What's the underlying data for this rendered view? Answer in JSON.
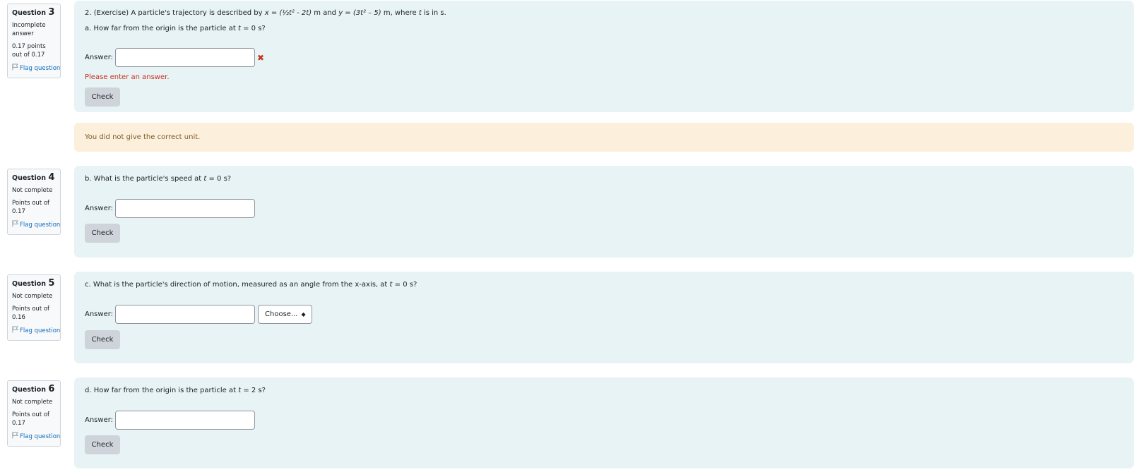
{
  "flag_label": "Flag question",
  "questions": [
    {
      "label": "Question",
      "number": "3",
      "state": "Incomplete answer",
      "grade": "0.17 points out of 0.17",
      "intro": {
        "prefix": "2. (Exercise) A particle's trajectory is described by ",
        "x_expr": "x = (½t² - 2t)",
        "mid": " m and ",
        "y_expr": "y = (3t² – 5)",
        "suffix": " m, where ",
        "t": "t",
        "end": " is in s."
      },
      "part": {
        "prefix": "a. How far from the origin is the particle at ",
        "var": "t",
        "suffix": " = 0 s?"
      },
      "answer_label": "Answer:",
      "answer_value": "",
      "error": "Please enter an answer.",
      "check_label": "Check"
    },
    {
      "label": "Question",
      "number": "4",
      "state": "Not complete",
      "grade": "Points out of 0.17",
      "part": {
        "prefix": "b. What is the particle's speed at ",
        "var": "t",
        "suffix": " = 0 s?"
      },
      "answer_label": "Answer:",
      "answer_value": "",
      "check_label": "Check"
    },
    {
      "label": "Question",
      "number": "5",
      "state": "Not complete",
      "grade": "Points out of 0.16",
      "part": {
        "prefix": "c. What is the particle's direction of motion, measured as an angle from the x-axis, at ",
        "var": "t",
        "suffix": " = 0 s?"
      },
      "answer_label": "Answer:",
      "answer_value": "",
      "select_label": "Choose...",
      "check_label": "Check"
    },
    {
      "label": "Question",
      "number": "6",
      "state": "Not complete",
      "grade": "Points out of 0.17",
      "part": {
        "prefix": "d. How far from the origin is the particle at ",
        "var": "t",
        "suffix": " = 2 s?"
      },
      "answer_label": "Answer:",
      "answer_value": "",
      "check_label": "Check"
    }
  ],
  "feedback": "You did not give the correct unit.",
  "colors": {
    "error": "#ca3120",
    "link": "#0f6cbf",
    "question_bg": "#e7f3f5",
    "feedback_bg": "#fcefdc"
  }
}
